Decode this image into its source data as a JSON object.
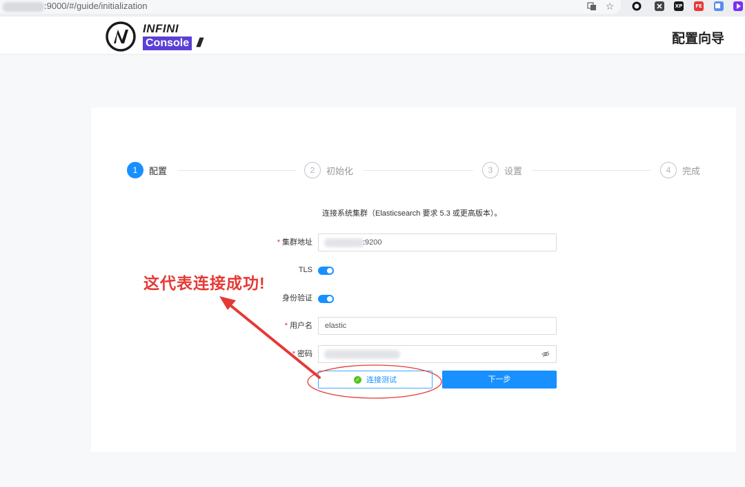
{
  "browser": {
    "url": ":9000/#/guide/initialization",
    "extensions": [
      "XP",
      "FE"
    ]
  },
  "header": {
    "logo_top": "INFINI",
    "logo_bottom": "Console",
    "logo_slashes": "///",
    "title": "配置向导"
  },
  "steps": [
    {
      "num": "1",
      "label": "配置",
      "active": true
    },
    {
      "num": "2",
      "label": "初始化",
      "active": false
    },
    {
      "num": "3",
      "label": "设置",
      "active": false
    },
    {
      "num": "4",
      "label": "完成",
      "active": false
    }
  ],
  "form": {
    "intro": "连接系统集群（Elasticsearch 要求 5.3 或更高版本）。",
    "required_mark": "*",
    "cluster_label": "集群地址",
    "cluster_value": ":9200",
    "tls_label": "TLS",
    "tls_on": true,
    "auth_label": "身份验证",
    "auth_on": true,
    "username_label": "用户名",
    "username_value": "elastic",
    "password_label": "密码",
    "test_button": "连接测试",
    "next_button": "下一步"
  },
  "annotation": {
    "text": "这代表连接成功!",
    "color": "#e53935"
  },
  "colors": {
    "primary": "#1890ff",
    "success": "#52c41a",
    "brand": "#5b3fd6"
  }
}
